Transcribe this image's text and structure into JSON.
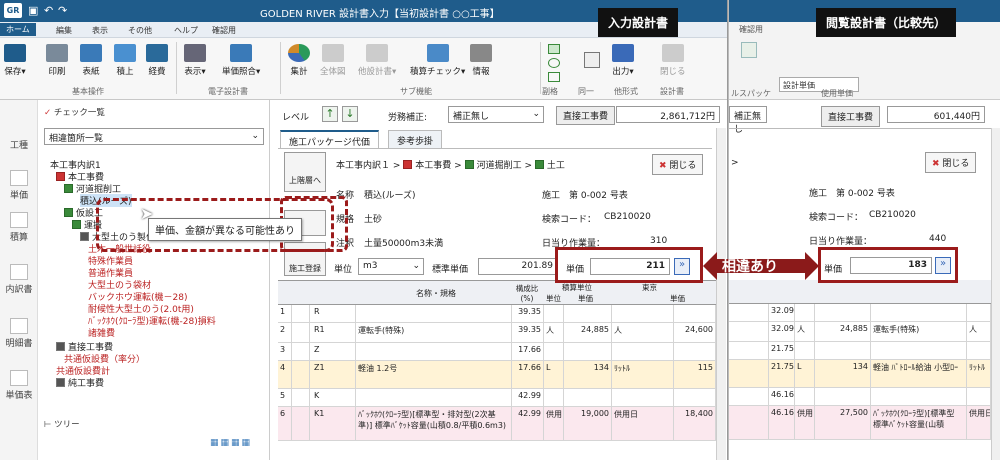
{
  "left_window": {
    "title": "GOLDEN RIVER 設計書入力【当初設計書 ○○工事】",
    "logo": "GR",
    "menus": [
      "ホーム",
      "編集",
      "表示",
      "その他",
      "ヘルプ",
      "確認用"
    ],
    "ribbon": {
      "buttons": [
        "保存",
        "印刷",
        "表紙",
        "積上",
        "経費",
        "表示",
        "単価照合",
        "集計",
        "全体図",
        "他設計書",
        "積算チェック",
        "情報",
        "出力",
        "閉じる"
      ],
      "groups": [
        "基本操作",
        "電子設計書",
        "サブ機能",
        "他形式",
        "設計書"
      ],
      "small_labels": [
        "閲覧設計書",
        "同一",
        "副格",
        "一"
      ]
    },
    "strip_items": [
      "工種",
      "単価",
      "積算",
      "内訳書",
      "明細書",
      "単価表"
    ],
    "tree": {
      "header": "チェック一覧",
      "combo": "相違箇所一覧",
      "nodes": [
        "本工事内訳1",
        "本工事費",
        "河道掘削工",
        "積込(ルーズ)",
        "仮設工",
        "運搬",
        "大型土のう製作",
        "土木一般世話役",
        "特殊作業員",
        "普通作業員",
        "大型土のう袋材",
        "バックホウ運転(機－28)",
        "耐候性大型土のう(2.0t用)",
        "ﾊﾞｯｸﾎｳ(ｸﾛｰﾗ型)運転(機-28)損料",
        "諸雑費",
        "直接工事費",
        "共通仮設費（率分）",
        "共通仮設費計",
        "純工事費"
      ],
      "footer": "ツリー"
    },
    "main": {
      "level_label": "レベル",
      "labor_label": "労務補正:",
      "labor_value": "補正無し",
      "direct_cost_label": "直接工事費",
      "direct_cost_value": "2,861,712円",
      "tabs": [
        "施工パッケージ代価",
        "参考歩掛"
      ],
      "up_btn": "上階層へ",
      "breadcrumb": [
        "本工事内訳１",
        "本工事費",
        "河道掘削工",
        "土工"
      ],
      "close_btn": "閉じる",
      "register_btn": "施工登録",
      "name_label": "名称",
      "name_value": "積込(ルーズ)",
      "spec_label": "規格",
      "spec_value": "土砂",
      "note_label": "注釈",
      "note_value": "土量50000m3未満",
      "sheet_label": "施工　第 0-002 号表",
      "search_label": "検索コード：",
      "search_value": "CB210020",
      "daily_label": "日当り作業量：",
      "daily_value": "310",
      "unit_label": "単位",
      "unit_value": "m3",
      "std_price_label": "標準単価",
      "std_price_value": "201.89",
      "price_label": "単価",
      "price_value": "211",
      "grid_headers": [
        "名称・規格",
        "構成比(%)",
        "積算単位",
        "単価",
        "単位",
        "東京",
        "単価"
      ],
      "grid_rows": [
        {
          "n": "1",
          "code": "R",
          "name": "",
          "ratio": "39.35",
          "u1": "",
          "p1": "",
          "u2": "",
          "p2": ""
        },
        {
          "n": "2",
          "code": "R1",
          "name": "運転手(特殊)",
          "ratio": "39.35",
          "u1": "人",
          "p1": "24,885",
          "u2": "人",
          "p2": "24,600"
        },
        {
          "n": "3",
          "code": "Z",
          "name": "",
          "ratio": "17.66",
          "u1": "",
          "p1": "",
          "u2": "",
          "p2": ""
        },
        {
          "n": "4",
          "code": "Z1",
          "name": "軽油 1.2号",
          "ratio": "17.66",
          "u1": "L",
          "p1": "134",
          "u2": "ﾘｯﾄﾙ",
          "p2": "115"
        },
        {
          "n": "5",
          "code": "K",
          "name": "",
          "ratio": "42.99",
          "u1": "",
          "p1": "",
          "u2": "",
          "p2": ""
        },
        {
          "n": "6",
          "code": "K1",
          "name": "ﾊﾞｯｸﾎｳ(ｸﾛｰﾗ型)[標準型・排対型(2次基準)] 標準ﾊﾞｹｯﾄ容量(山積0.8/平積0.6m3)",
          "ratio": "42.99",
          "u1": "供用日",
          "p1": "19,000",
          "u2": "供用日",
          "p2": "18,400"
        }
      ]
    }
  },
  "right_window": {
    "ribbon_tabs": [
      "確認用"
    ],
    "combo": "設計単価",
    "group_labels": [
      "ルスパッケ",
      "使用単価"
    ],
    "labor_value": "補正無し",
    "direct_cost_label": "直接工事費",
    "direct_cost_value": "601,440円",
    "close_btn": "閉じる",
    "sheet_label": "施工　第 0-002 号表",
    "search_label": "検索コード：",
    "search_value": "CB210020",
    "daily_label": "日当り作業量：",
    "daily_value": "440",
    "price_label": "単価",
    "price_value": "183",
    "grid_rows": [
      {
        "ratio": "32.09",
        "u1": "",
        "p1": "",
        "name": "",
        "u2": ""
      },
      {
        "ratio": "32.09",
        "u1": "人",
        "p1": "24,885",
        "name": "運転手(特殊)",
        "u2": "人"
      },
      {
        "ratio": "21.75",
        "u1": "",
        "p1": "",
        "name": "",
        "u2": ""
      },
      {
        "ratio": "21.75",
        "u1": "L",
        "p1": "134",
        "name": "軽油 ﾊﾞﾄﾛｰﾙ給油 小型ﾛｰ",
        "u2": "ﾘｯﾄﾙ"
      },
      {
        "ratio": "46.16",
        "u1": "",
        "p1": "",
        "name": "",
        "u2": ""
      },
      {
        "ratio": "46.16",
        "u1": "供用日",
        "p1": "27,500",
        "name": "ﾊﾞｯｸﾎｳ(ｸﾛｰﾗ型)[標準型 標準ﾊﾞｹｯﾄ容量(山積",
        "u2": "供用日"
      }
    ]
  },
  "callouts": {
    "input_title": "入力設計書",
    "compare_title": "閲覧設計書（比較先）",
    "diff_label": "相違あり",
    "tooltip": "単価、金額が異なる可能性あり"
  }
}
